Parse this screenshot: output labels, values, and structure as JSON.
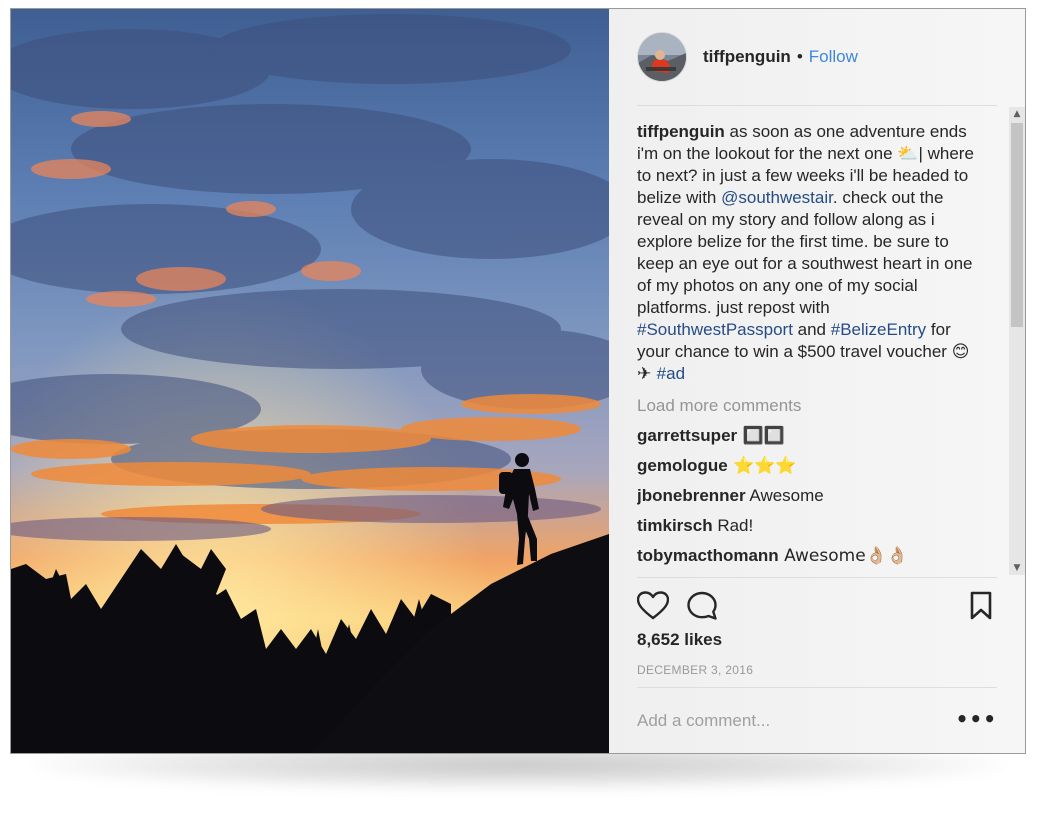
{
  "header": {
    "username": "tiffpenguin",
    "separator": "•",
    "follow_label": "Follow"
  },
  "caption": {
    "username": "tiffpenguin",
    "part1": " as soon as one adventure ends i'm on the lookout for the next one ",
    "emoji1": "⛅",
    "part2": "| where to next? in just a few weeks i'll be headed to belize with ",
    "mention": "@southwestair",
    "part3": ". check out the reveal on my story and follow along as i explore belize for the first time. be sure to keep an eye out for a southwest heart in one of my photos on any one of my social platforms. just repost with ",
    "hashtag1": "#SouthwestPassport",
    "part4": " and ",
    "hashtag2": "#BelizeEntry",
    "part5": " for your chance to win a $500 travel voucher ",
    "emoji2": "😊",
    "part6": " ✈ ",
    "hashtag3": "#ad"
  },
  "load_more_label": "Load more comments",
  "comments": [
    {
      "user": "garrettsuper",
      "text": " 🔲🔲"
    },
    {
      "user": "gemologue",
      "text": " ⭐⭐⭐"
    },
    {
      "user": "jbonebrenner",
      "text": " Awesome"
    },
    {
      "user": "timkirsch",
      "text": " Rad!"
    },
    {
      "user": "tobymacthomann",
      "text": " Awesome👌🏼👌🏼"
    }
  ],
  "likes": "8,652 likes",
  "date": "DECEMBER 3, 2016",
  "add_comment_placeholder": "Add a comment...",
  "more_options": "•••",
  "icons": {
    "like": "heart-icon",
    "comment": "comment-icon",
    "save": "bookmark-icon"
  },
  "colors": {
    "link": "#264c86",
    "follow": "#3f88d9",
    "muted": "#999999"
  }
}
